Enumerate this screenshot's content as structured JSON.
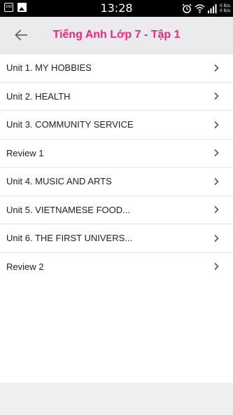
{
  "status_bar": {
    "time": "13:28",
    "net_speed_up": "0 B/s",
    "net_speed_down": "0 B/s",
    "left_icon_text": "100"
  },
  "header": {
    "title": "Tiếng Anh Lớp 7 - Tập 1",
    "back_icon": "arrow-left-icon"
  },
  "colors": {
    "accent": "#f2277d",
    "header_bg": "#ebeaec",
    "text": "#222222",
    "chevron": "#555555"
  },
  "units": [
    {
      "label": "Unit 1. MY HOBBIES"
    },
    {
      "label": "Unit 2. HEALTH"
    },
    {
      "label": "Unit 3. COMMUNITY SERVICE"
    },
    {
      "label": "Review 1"
    },
    {
      "label": "Unit 4. MUSIC AND ARTS"
    },
    {
      "label": "Unit 5. VIETNAMESE FOOD..."
    },
    {
      "label": "Unit 6. THE FIRST UNIVERS..."
    },
    {
      "label": "Review 2"
    }
  ]
}
